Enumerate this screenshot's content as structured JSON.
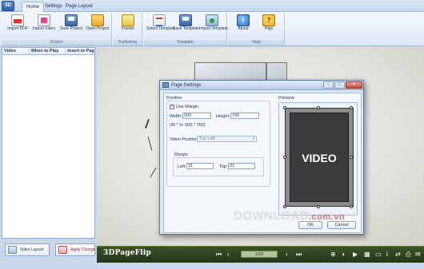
{
  "app": {
    "icon_text": "3D"
  },
  "tabs": [
    {
      "label": "Home",
      "active": true
    },
    {
      "label": "Settings",
      "active": false
    },
    {
      "label": "Page Layout",
      "active": false
    }
  ],
  "ribbon": {
    "groups": [
      {
        "label": "Project",
        "buttons": [
          {
            "label": "Import PDF",
            "icon": "import-pdf-icon"
          },
          {
            "label": "Import Video",
            "icon": "import-video-icon"
          },
          {
            "label": "Save Project",
            "icon": "save-project-icon"
          },
          {
            "label": "Open Project",
            "icon": "open-project-icon"
          }
        ]
      },
      {
        "label": "Publishing",
        "buttons": [
          {
            "label": "Publish",
            "icon": "publish-icon"
          }
        ]
      },
      {
        "label": "Template",
        "buttons": [
          {
            "label": "Select Template",
            "icon": "select-template-icon"
          },
          {
            "label": "Save Template",
            "icon": "save-template-icon"
          },
          {
            "label": "Import Template",
            "icon": "import-template-icon"
          }
        ]
      },
      {
        "label": "Help",
        "buttons": [
          {
            "label": "About",
            "icon": "about-icon"
          },
          {
            "label": "Help",
            "icon": "help-icon"
          }
        ]
      }
    ]
  },
  "video_table": {
    "columns": [
      "Video",
      "When to Play",
      "Insert to Page"
    ]
  },
  "left_buttons": {
    "video_layout": "Video Layout",
    "apply_change": "Apply Change"
  },
  "flipbar": {
    "brand": "3DPageFlip",
    "page_value": "1/52"
  },
  "dialog": {
    "title": "Page Settings",
    "position_label": "Position",
    "use_margin_label": "Use Margin",
    "use_margin_checked": true,
    "width_label": "Width:",
    "width_value": "500",
    "height_label": "Height:",
    "height_value": "700",
    "size_hint": "(W * H: 500 * 750)",
    "video_position_label": "Video Position:",
    "video_position_value": "Top Left",
    "margin_label": "Margin",
    "left_label": "Left:",
    "left_value": "31",
    "top_label": "Top:",
    "top_value": "31",
    "preview_label": "Preview",
    "preview_text": "VIDEO",
    "ok_label": "OK",
    "cancel_label": "Cancel"
  },
  "watermark": {
    "main": "DOWNLOAD",
    "domain": ".com.vn"
  }
}
